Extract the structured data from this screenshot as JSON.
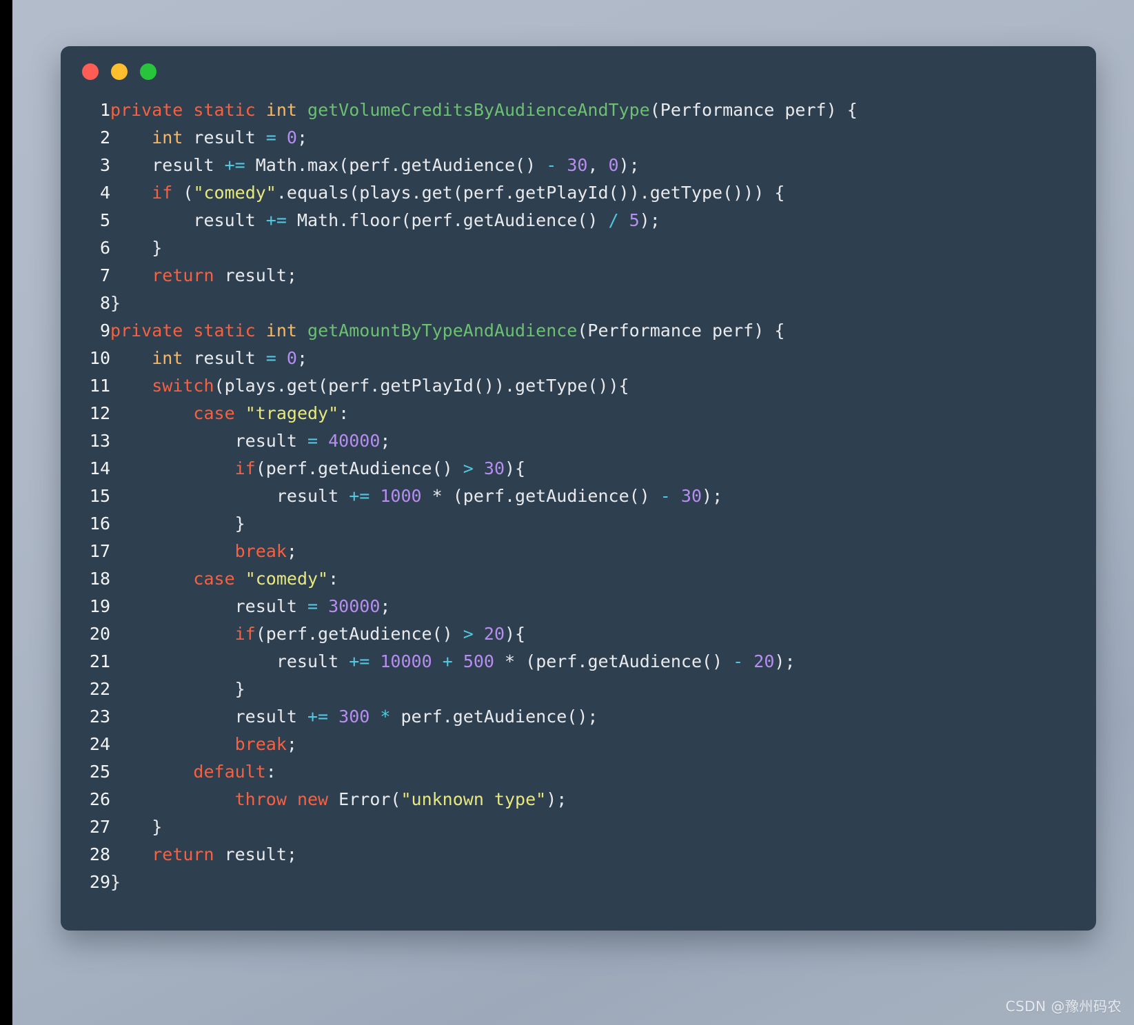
{
  "window": {
    "background_color": "#2e3f50",
    "page_background_top": "#b2bcca",
    "page_background_bottom": "#a7b2c0",
    "traffic_lights": [
      {
        "name": "close",
        "color": "#fd5d55"
      },
      {
        "name": "minimize",
        "color": "#ffbe2e"
      },
      {
        "name": "zoom",
        "color": "#28c43c"
      }
    ]
  },
  "palette": {
    "keyword": "#f9603f",
    "type": "#fdb760",
    "function": "#6cc071",
    "number": "#b78df0",
    "operator": "#52c8e0",
    "string": "#e8e87d",
    "plain": "#e8eaed",
    "line_number": "#f2f4f6"
  },
  "code": {
    "language": "java",
    "line_count": 29,
    "lines": [
      {
        "n": "1",
        "tokens": [
          {
            "t": "private",
            "c": "kw"
          },
          {
            "t": " ",
            "c": "pl"
          },
          {
            "t": "static",
            "c": "kw"
          },
          {
            "t": " ",
            "c": "pl"
          },
          {
            "t": "int",
            "c": "typ"
          },
          {
            "t": " ",
            "c": "pl"
          },
          {
            "t": "getVolumeCreditsByAudienceAndType",
            "c": "fn"
          },
          {
            "t": "(Performance perf) {",
            "c": "pl"
          }
        ]
      },
      {
        "n": "2",
        "tokens": [
          {
            "t": "    ",
            "c": "pl"
          },
          {
            "t": "int",
            "c": "typ"
          },
          {
            "t": " result ",
            "c": "pl"
          },
          {
            "t": "=",
            "c": "op"
          },
          {
            "t": " ",
            "c": "pl"
          },
          {
            "t": "0",
            "c": "num"
          },
          {
            "t": ";",
            "c": "pl"
          }
        ]
      },
      {
        "n": "3",
        "tokens": [
          {
            "t": "    result ",
            "c": "pl"
          },
          {
            "t": "+=",
            "c": "op"
          },
          {
            "t": " Math.max(perf.getAudience() ",
            "c": "pl"
          },
          {
            "t": "-",
            "c": "op"
          },
          {
            "t": " ",
            "c": "pl"
          },
          {
            "t": "30",
            "c": "num"
          },
          {
            "t": ", ",
            "c": "pl"
          },
          {
            "t": "0",
            "c": "num"
          },
          {
            "t": ");",
            "c": "pl"
          }
        ]
      },
      {
        "n": "4",
        "tokens": [
          {
            "t": "    ",
            "c": "pl"
          },
          {
            "t": "if",
            "c": "kw"
          },
          {
            "t": " (",
            "c": "pl"
          },
          {
            "t": "\"comedy\"",
            "c": "str"
          },
          {
            "t": ".equals(plays.get(perf.getPlayId()).getType())) {",
            "c": "pl"
          }
        ]
      },
      {
        "n": "5",
        "tokens": [
          {
            "t": "        result ",
            "c": "pl"
          },
          {
            "t": "+=",
            "c": "op"
          },
          {
            "t": " Math.floor(perf.getAudience() ",
            "c": "pl"
          },
          {
            "t": "/",
            "c": "op"
          },
          {
            "t": " ",
            "c": "pl"
          },
          {
            "t": "5",
            "c": "num"
          },
          {
            "t": ");",
            "c": "pl"
          }
        ]
      },
      {
        "n": "6",
        "tokens": [
          {
            "t": "    }",
            "c": "pl"
          }
        ]
      },
      {
        "n": "7",
        "tokens": [
          {
            "t": "    ",
            "c": "pl"
          },
          {
            "t": "return",
            "c": "kw"
          },
          {
            "t": " result;",
            "c": "pl"
          }
        ]
      },
      {
        "n": "8",
        "tokens": [
          {
            "t": "}",
            "c": "pl"
          }
        ]
      },
      {
        "n": "9",
        "tokens": [
          {
            "t": "private",
            "c": "kw"
          },
          {
            "t": " ",
            "c": "pl"
          },
          {
            "t": "static",
            "c": "kw"
          },
          {
            "t": " ",
            "c": "pl"
          },
          {
            "t": "int",
            "c": "typ"
          },
          {
            "t": " ",
            "c": "pl"
          },
          {
            "t": "getAmountByTypeAndAudience",
            "c": "fn"
          },
          {
            "t": "(Performance perf) {",
            "c": "pl"
          }
        ]
      },
      {
        "n": "10",
        "tokens": [
          {
            "t": "    ",
            "c": "pl"
          },
          {
            "t": "int",
            "c": "typ"
          },
          {
            "t": " result ",
            "c": "pl"
          },
          {
            "t": "=",
            "c": "op"
          },
          {
            "t": " ",
            "c": "pl"
          },
          {
            "t": "0",
            "c": "num"
          },
          {
            "t": ";",
            "c": "pl"
          }
        ]
      },
      {
        "n": "11",
        "tokens": [
          {
            "t": "    ",
            "c": "pl"
          },
          {
            "t": "switch",
            "c": "kw"
          },
          {
            "t": "(plays.get(perf.getPlayId()).getType()){",
            "c": "pl"
          }
        ]
      },
      {
        "n": "12",
        "tokens": [
          {
            "t": "        ",
            "c": "pl"
          },
          {
            "t": "case",
            "c": "kw"
          },
          {
            "t": " ",
            "c": "pl"
          },
          {
            "t": "\"tragedy\"",
            "c": "str"
          },
          {
            "t": ":",
            "c": "pl"
          }
        ]
      },
      {
        "n": "13",
        "tokens": [
          {
            "t": "            result ",
            "c": "pl"
          },
          {
            "t": "=",
            "c": "op"
          },
          {
            "t": " ",
            "c": "pl"
          },
          {
            "t": "40000",
            "c": "num"
          },
          {
            "t": ";",
            "c": "pl"
          }
        ]
      },
      {
        "n": "14",
        "tokens": [
          {
            "t": "            ",
            "c": "pl"
          },
          {
            "t": "if",
            "c": "kw"
          },
          {
            "t": "(perf.getAudience() ",
            "c": "pl"
          },
          {
            "t": ">",
            "c": "op"
          },
          {
            "t": " ",
            "c": "pl"
          },
          {
            "t": "30",
            "c": "num"
          },
          {
            "t": "){",
            "c": "pl"
          }
        ]
      },
      {
        "n": "15",
        "tokens": [
          {
            "t": "                result ",
            "c": "pl"
          },
          {
            "t": "+=",
            "c": "op"
          },
          {
            "t": " ",
            "c": "pl"
          },
          {
            "t": "1000",
            "c": "num"
          },
          {
            "t": " ",
            "c": "pl"
          },
          {
            "t": "*",
            "c": "pl"
          },
          {
            "t": " (perf.getAudience() ",
            "c": "pl"
          },
          {
            "t": "-",
            "c": "op"
          },
          {
            "t": " ",
            "c": "pl"
          },
          {
            "t": "30",
            "c": "num"
          },
          {
            "t": ");",
            "c": "pl"
          }
        ]
      },
      {
        "n": "16",
        "tokens": [
          {
            "t": "            }",
            "c": "pl"
          }
        ]
      },
      {
        "n": "17",
        "tokens": [
          {
            "t": "            ",
            "c": "pl"
          },
          {
            "t": "break",
            "c": "kw"
          },
          {
            "t": ";",
            "c": "pl"
          }
        ]
      },
      {
        "n": "18",
        "tokens": [
          {
            "t": "        ",
            "c": "pl"
          },
          {
            "t": "case",
            "c": "kw"
          },
          {
            "t": " ",
            "c": "pl"
          },
          {
            "t": "\"comedy\"",
            "c": "str"
          },
          {
            "t": ":",
            "c": "pl"
          }
        ]
      },
      {
        "n": "19",
        "tokens": [
          {
            "t": "            result ",
            "c": "pl"
          },
          {
            "t": "=",
            "c": "op"
          },
          {
            "t": " ",
            "c": "pl"
          },
          {
            "t": "30000",
            "c": "num"
          },
          {
            "t": ";",
            "c": "pl"
          }
        ]
      },
      {
        "n": "20",
        "tokens": [
          {
            "t": "            ",
            "c": "pl"
          },
          {
            "t": "if",
            "c": "kw"
          },
          {
            "t": "(perf.getAudience() ",
            "c": "pl"
          },
          {
            "t": ">",
            "c": "op"
          },
          {
            "t": " ",
            "c": "pl"
          },
          {
            "t": "20",
            "c": "num"
          },
          {
            "t": "){",
            "c": "pl"
          }
        ]
      },
      {
        "n": "21",
        "tokens": [
          {
            "t": "                result ",
            "c": "pl"
          },
          {
            "t": "+=",
            "c": "op"
          },
          {
            "t": " ",
            "c": "pl"
          },
          {
            "t": "10000",
            "c": "num"
          },
          {
            "t": " ",
            "c": "pl"
          },
          {
            "t": "+",
            "c": "op"
          },
          {
            "t": " ",
            "c": "pl"
          },
          {
            "t": "500",
            "c": "num"
          },
          {
            "t": " ",
            "c": "pl"
          },
          {
            "t": "*",
            "c": "pl"
          },
          {
            "t": " (perf.getAudience() ",
            "c": "pl"
          },
          {
            "t": "-",
            "c": "op"
          },
          {
            "t": " ",
            "c": "pl"
          },
          {
            "t": "20",
            "c": "num"
          },
          {
            "t": ");",
            "c": "pl"
          }
        ]
      },
      {
        "n": "22",
        "tokens": [
          {
            "t": "            }",
            "c": "pl"
          }
        ]
      },
      {
        "n": "23",
        "tokens": [
          {
            "t": "            result ",
            "c": "pl"
          },
          {
            "t": "+=",
            "c": "op"
          },
          {
            "t": " ",
            "c": "pl"
          },
          {
            "t": "300",
            "c": "num"
          },
          {
            "t": " ",
            "c": "pl"
          },
          {
            "t": "*",
            "c": "op"
          },
          {
            "t": " perf.getAudience();",
            "c": "pl"
          }
        ]
      },
      {
        "n": "24",
        "tokens": [
          {
            "t": "            ",
            "c": "pl"
          },
          {
            "t": "break",
            "c": "kw"
          },
          {
            "t": ";",
            "c": "pl"
          }
        ]
      },
      {
        "n": "25",
        "tokens": [
          {
            "t": "        ",
            "c": "pl"
          },
          {
            "t": "default",
            "c": "kw"
          },
          {
            "t": ":",
            "c": "pl"
          }
        ]
      },
      {
        "n": "26",
        "tokens": [
          {
            "t": "            ",
            "c": "pl"
          },
          {
            "t": "throw",
            "c": "kw"
          },
          {
            "t": " ",
            "c": "pl"
          },
          {
            "t": "new",
            "c": "kw"
          },
          {
            "t": " Error(",
            "c": "pl"
          },
          {
            "t": "\"unknown type\"",
            "c": "str"
          },
          {
            "t": ");",
            "c": "pl"
          }
        ]
      },
      {
        "n": "27",
        "tokens": [
          {
            "t": "    }",
            "c": "pl"
          }
        ]
      },
      {
        "n": "28",
        "tokens": [
          {
            "t": "    ",
            "c": "pl"
          },
          {
            "t": "return",
            "c": "kw"
          },
          {
            "t": " result;",
            "c": "pl"
          }
        ]
      },
      {
        "n": "29",
        "tokens": [
          {
            "t": "}",
            "c": "pl"
          }
        ]
      }
    ]
  },
  "watermark": {
    "text": "CSDN @豫州码农"
  }
}
